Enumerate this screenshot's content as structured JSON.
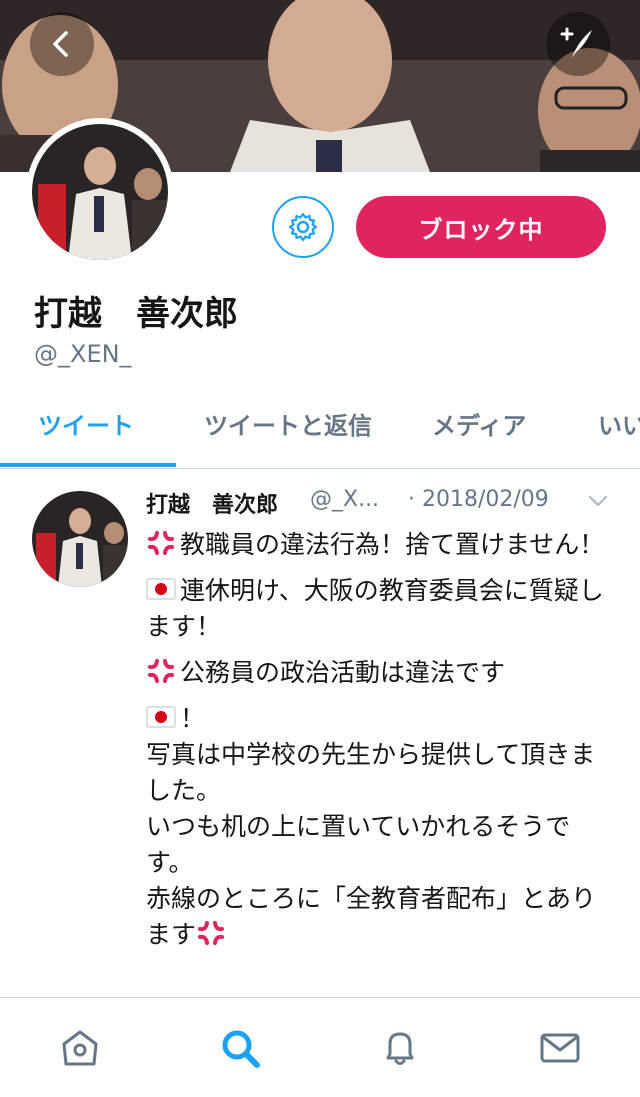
{
  "profile": {
    "display_name": "打越　善次郎",
    "handle": "@_XEN_",
    "block_label": "ブロック中"
  },
  "tabs": [
    {
      "label": "ツイート"
    },
    {
      "label": "ツイートと返信"
    },
    {
      "label": "メディア"
    },
    {
      "label": "いい"
    }
  ],
  "tweet": {
    "name": "打越　善次郎",
    "handle": "@_X...",
    "date": "· 2018/02/09",
    "lines": [
      "教職員の違法行為！捨て置けません！",
      "連休明け、大阪の教育委員会に質疑します！",
      "公務員の政治活動は違法です",
      "！",
      "写真は中学校の先生から提供して頂きました。",
      "いつも机の上に置いていかれるそうです。",
      "赤線のところに「全教育者配布」とあります"
    ]
  },
  "icons": {
    "back": "chevron-left-icon",
    "compose": "compose-tweet-icon",
    "settings": "gear-icon",
    "more": "chevron-down-icon",
    "anger": "anger-symbol-icon",
    "flag": "japan-flag-icon",
    "nav": [
      "home-icon",
      "search-icon",
      "notifications-icon",
      "messages-icon"
    ]
  },
  "colors": {
    "accent": "#1da1f2",
    "block": "#e0245e",
    "secondary_text": "#657786"
  },
  "bottom_nav": {
    "active_index": 1
  }
}
